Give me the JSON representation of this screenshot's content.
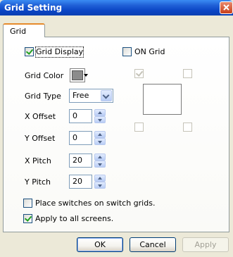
{
  "window": {
    "title": "Grid Setting"
  },
  "tabs": [
    {
      "label": "Grid"
    }
  ],
  "grid_display": {
    "label": "Grid Display",
    "checked": true
  },
  "on_grid": {
    "label": "ON Grid",
    "checked": false
  },
  "grid_color": {
    "label": "Grid Color",
    "color": "#8c8c8c"
  },
  "grid_type": {
    "label": "Grid Type",
    "value": "Free"
  },
  "x_offset": {
    "label": "X Offset",
    "value": "0"
  },
  "y_offset": {
    "label": "Y Offset",
    "value": "0"
  },
  "x_pitch": {
    "label": "X Pitch",
    "value": "20"
  },
  "y_pitch": {
    "label": "Y Pitch",
    "value": "20"
  },
  "place_switches": {
    "label": "Place switches on switch grids.",
    "checked": false
  },
  "apply_all": {
    "label": "Apply to all screens.",
    "checked": true
  },
  "buttons": {
    "ok": "OK",
    "cancel": "Cancel",
    "apply": "Apply"
  }
}
